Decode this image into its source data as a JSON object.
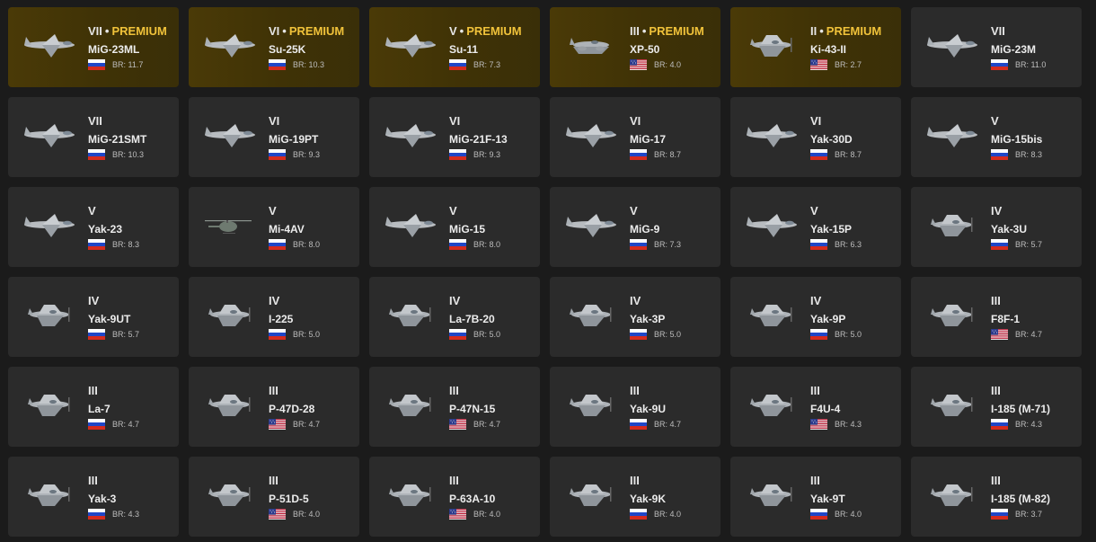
{
  "prefix": {
    "premium": "PREMIUM",
    "br_label": "BR:"
  },
  "colors": {
    "premium_text": "#f0c23a",
    "premium_bg": "#4a3a07",
    "card_bg": "#2b2b2b",
    "page_bg": "#1b1b1b"
  },
  "vehicles": [
    {
      "rank": "VII",
      "premium": true,
      "name": "MiG-23ML",
      "nation": "ussr",
      "br": "11.7",
      "icon": "jet-icon"
    },
    {
      "rank": "VI",
      "premium": true,
      "name": "Su-25K",
      "nation": "ussr",
      "br": "10.3",
      "icon": "jet-icon"
    },
    {
      "rank": "V",
      "premium": true,
      "name": "Su-11",
      "nation": "ussr",
      "br": "7.3",
      "icon": "jet-icon"
    },
    {
      "rank": "III",
      "premium": true,
      "name": "XP-50",
      "nation": "usa",
      "br": "4.0",
      "icon": "twin-prop-icon"
    },
    {
      "rank": "II",
      "premium": true,
      "name": "Ki-43-II",
      "nation": "usa",
      "br": "2.7",
      "icon": "prop-plane-icon"
    },
    {
      "rank": "VII",
      "premium": false,
      "name": "MiG-23M",
      "nation": "ussr",
      "br": "11.0",
      "icon": "jet-icon"
    },
    {
      "rank": "VII",
      "premium": false,
      "name": "MiG-21SMT",
      "nation": "ussr",
      "br": "10.3",
      "icon": "jet-icon"
    },
    {
      "rank": "VI",
      "premium": false,
      "name": "MiG-19PT",
      "nation": "ussr",
      "br": "9.3",
      "icon": "jet-icon"
    },
    {
      "rank": "VI",
      "premium": false,
      "name": "MiG-21F-13",
      "nation": "ussr",
      "br": "9.3",
      "icon": "jet-icon"
    },
    {
      "rank": "VI",
      "premium": false,
      "name": "MiG-17",
      "nation": "ussr",
      "br": "8.7",
      "icon": "jet-icon"
    },
    {
      "rank": "VI",
      "premium": false,
      "name": "Yak-30D",
      "nation": "ussr",
      "br": "8.7",
      "icon": "jet-icon"
    },
    {
      "rank": "V",
      "premium": false,
      "name": "MiG-15bis",
      "nation": "ussr",
      "br": "8.3",
      "icon": "jet-icon"
    },
    {
      "rank": "V",
      "premium": false,
      "name": "Yak-23",
      "nation": "ussr",
      "br": "8.3",
      "icon": "jet-icon"
    },
    {
      "rank": "V",
      "premium": false,
      "name": "Mi-4AV",
      "nation": "ussr",
      "br": "8.0",
      "icon": "helicopter-icon"
    },
    {
      "rank": "V",
      "premium": false,
      "name": "MiG-15",
      "nation": "ussr",
      "br": "8.0",
      "icon": "jet-icon"
    },
    {
      "rank": "V",
      "premium": false,
      "name": "MiG-9",
      "nation": "ussr",
      "br": "7.3",
      "icon": "jet-icon"
    },
    {
      "rank": "V",
      "premium": false,
      "name": "Yak-15P",
      "nation": "ussr",
      "br": "6.3",
      "icon": "jet-icon"
    },
    {
      "rank": "IV",
      "premium": false,
      "name": "Yak-3U",
      "nation": "ussr",
      "br": "5.7",
      "icon": "prop-plane-icon"
    },
    {
      "rank": "IV",
      "premium": false,
      "name": "Yak-9UT",
      "nation": "ussr",
      "br": "5.7",
      "icon": "prop-plane-icon"
    },
    {
      "rank": "IV",
      "premium": false,
      "name": "I-225",
      "nation": "ussr",
      "br": "5.0",
      "icon": "prop-plane-icon"
    },
    {
      "rank": "IV",
      "premium": false,
      "name": "La-7B-20",
      "nation": "ussr",
      "br": "5.0",
      "icon": "prop-plane-icon"
    },
    {
      "rank": "IV",
      "premium": false,
      "name": "Yak-3P",
      "nation": "ussr",
      "br": "5.0",
      "icon": "prop-plane-icon"
    },
    {
      "rank": "IV",
      "premium": false,
      "name": "Yak-9P",
      "nation": "ussr",
      "br": "5.0",
      "icon": "prop-plane-icon"
    },
    {
      "rank": "III",
      "premium": false,
      "name": "F8F-1",
      "nation": "usa",
      "br": "4.7",
      "icon": "prop-plane-icon"
    },
    {
      "rank": "III",
      "premium": false,
      "name": "La-7",
      "nation": "ussr",
      "br": "4.7",
      "icon": "prop-plane-icon"
    },
    {
      "rank": "III",
      "premium": false,
      "name": "P-47D-28",
      "nation": "usa",
      "br": "4.7",
      "icon": "prop-plane-icon"
    },
    {
      "rank": "III",
      "premium": false,
      "name": "P-47N-15",
      "nation": "usa",
      "br": "4.7",
      "icon": "prop-plane-icon"
    },
    {
      "rank": "III",
      "premium": false,
      "name": "Yak-9U",
      "nation": "ussr",
      "br": "4.7",
      "icon": "prop-plane-icon"
    },
    {
      "rank": "III",
      "premium": false,
      "name": "F4U-4",
      "nation": "usa",
      "br": "4.3",
      "icon": "prop-plane-icon"
    },
    {
      "rank": "III",
      "premium": false,
      "name": "I-185 (M-71)",
      "nation": "ussr",
      "br": "4.3",
      "icon": "prop-plane-icon"
    },
    {
      "rank": "III",
      "premium": false,
      "name": "Yak-3",
      "nation": "ussr",
      "br": "4.3",
      "icon": "prop-plane-icon"
    },
    {
      "rank": "III",
      "premium": false,
      "name": "P-51D-5",
      "nation": "usa",
      "br": "4.0",
      "icon": "prop-plane-icon"
    },
    {
      "rank": "III",
      "premium": false,
      "name": "P-63A-10",
      "nation": "usa",
      "br": "4.0",
      "icon": "prop-plane-icon"
    },
    {
      "rank": "III",
      "premium": false,
      "name": "Yak-9K",
      "nation": "ussr",
      "br": "4.0",
      "icon": "prop-plane-icon"
    },
    {
      "rank": "III",
      "premium": false,
      "name": "Yak-9T",
      "nation": "ussr",
      "br": "4.0",
      "icon": "prop-plane-icon"
    },
    {
      "rank": "III",
      "premium": false,
      "name": "I-185 (M-82)",
      "nation": "ussr",
      "br": "3.7",
      "icon": "prop-plane-icon"
    }
  ]
}
